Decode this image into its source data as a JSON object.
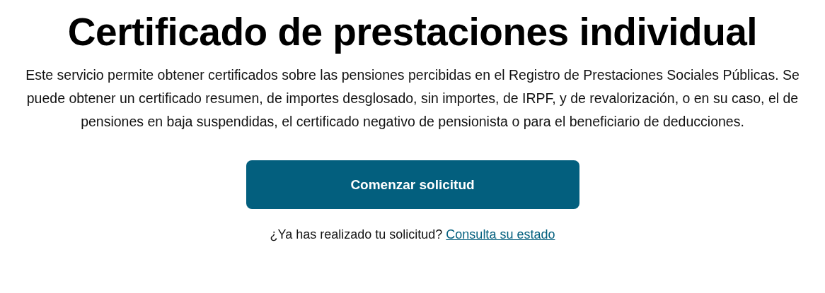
{
  "title": "Certificado de prestaciones individual",
  "description": "Este servicio permite obtener certificados sobre las pensiones percibidas en el Registro de Prestaciones Sociales Públicas. Se puede obtener un certificado resumen, de importes desglosado, sin importes, de IRPF, y de revalorización, o en su caso, el de pensiones en baja suspendidas, el certificado negativo de pensionista o para el beneficiario de deducciones.",
  "start_button": {
    "label": "Comenzar solicitud"
  },
  "status_prompt": {
    "text": "¿Ya has realizado tu solicitud?",
    "link": "Consulta su estado"
  }
}
